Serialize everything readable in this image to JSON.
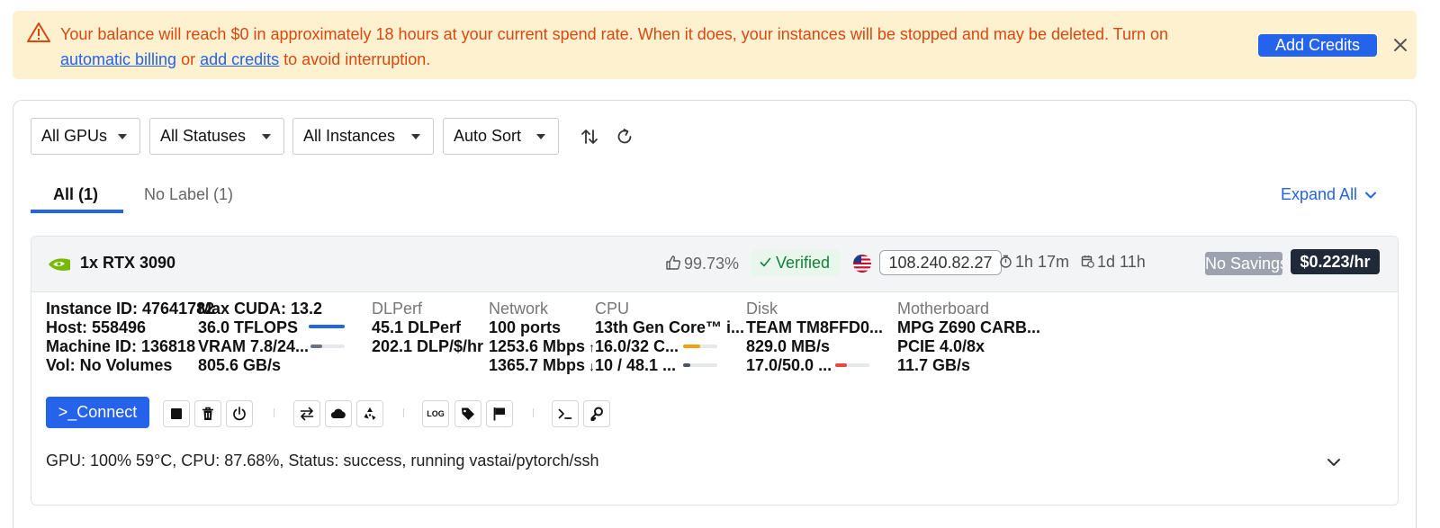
{
  "banner": {
    "text_pre": "Your balance will reach $0 in approximately 18 hours at your current spend rate. When it does, your instances will be stopped and may be deleted. Turn on ",
    "link1": "automatic billing",
    "text_mid": " or ",
    "link2": "add credits",
    "text_post": " to avoid interruption.",
    "button": "Add Credits",
    "icon": "warning-triangle-icon",
    "close_icon": "close-icon",
    "color": "#d9480f",
    "background": "#fdf1cf"
  },
  "filters": {
    "gpus": "All GPUs",
    "statuses": "All Statuses",
    "instances": "All Instances",
    "sort": "Auto Sort"
  },
  "tabs": [
    {
      "label": "All (1)",
      "active": true
    },
    {
      "label": "No Label (1)",
      "active": false
    }
  ],
  "expand_all": "Expand All",
  "instance": {
    "gpu": "1x RTX 3090",
    "reliability": "99.73%",
    "verified": "Verified",
    "ip": "108.240.82.27",
    "duration": "1h 17m",
    "remaining": "1d 11h",
    "savings": "No Savings",
    "price": "$0.223/hr",
    "details": {
      "instance_id": "Instance ID: 47641782",
      "host": "Host: 558496",
      "machine_id": "Machine ID: 136818",
      "vol": "Vol: No Volumes",
      "max_cuda": "Max CUDA: 13.2",
      "tflops": "36.0 TFLOPS",
      "vram": "VRAM 7.8/24...",
      "bandwidth": "805.6 GB/s",
      "dlperf_label": "DLPerf",
      "dlperf": "45.1 DLPerf",
      "dlp_price": "202.1 DLP/$/hr",
      "network_label": "Network",
      "ports": "100 ports",
      "upload": "1253.6 Mbps",
      "download": "1365.7 Mbps",
      "cpu_label": "CPU",
      "cpu_model": "13th Gen Core™ i...",
      "cpu_cores": "16.0/32 C...",
      "cpu_ram": "10 / 48.1 ...",
      "disk_label": "Disk",
      "disk_model": "TEAM TM8FFD0...",
      "disk_speed": "829.0 MB/s",
      "disk_usage": "17.0/50.0 ...",
      "mb_label": "Motherboard",
      "mb_model": "MPG Z690 CARB...",
      "pcie": "PCIE 4.0/8x",
      "pcie_bw": "11.7 GB/s"
    },
    "usage": {
      "tflops_fill": 1.0,
      "vram_fill": 0.33,
      "cpu_cores_fill": 0.5,
      "cpu_ram_fill": 0.21,
      "disk_fill": 0.34
    },
    "connect": ">_Connect",
    "status": "GPU: 100% 59°C, CPU: 87.68%, Status: success, running vastai/pytorch/ssh",
    "log_label": "LOG"
  }
}
